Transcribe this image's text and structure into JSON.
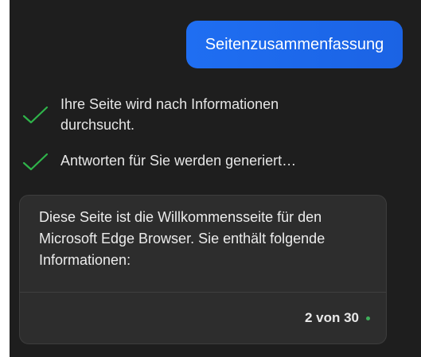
{
  "chat": {
    "user_message": "Seitenzusammenfassung",
    "steps": [
      {
        "text": "Ihre Seite wird nach Informationen durchsucht.",
        "icon": "check-icon"
      },
      {
        "text": "Antworten für Sie werden generiert…",
        "icon": "check-icon"
      }
    ],
    "answer": {
      "text": "Diese Seite ist die Willkommensseite für den Microsoft Edge Browser. Sie enthält folgende Informationen:",
      "counter": "2 von 30",
      "status_color": "#3fae5b"
    }
  },
  "colors": {
    "background": "#1e1e1e",
    "bubble": "#1f6ef2",
    "check": "#2fb44a",
    "card": "#2d2d2d"
  }
}
